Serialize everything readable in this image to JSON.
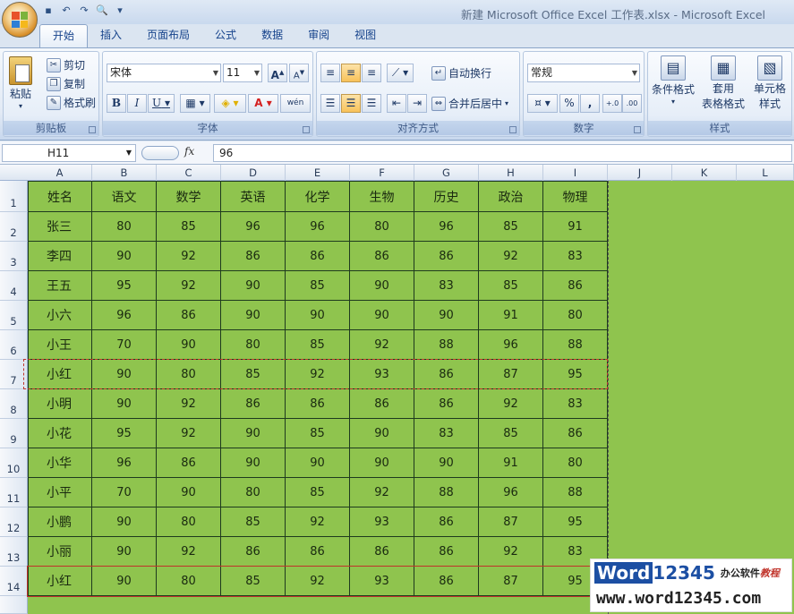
{
  "window": {
    "title": "新建 Microsoft Office Excel 工作表.xlsx - Microsoft Excel"
  },
  "quick_access": [
    {
      "icon": "save-icon",
      "glyph": "▪"
    },
    {
      "icon": "undo-icon",
      "glyph": "↶"
    },
    {
      "icon": "redo-icon",
      "glyph": "↷"
    },
    {
      "icon": "print-preview-icon",
      "glyph": "🔍"
    },
    {
      "icon": "customize-icon",
      "glyph": "▾"
    }
  ],
  "tabs": [
    "开始",
    "插入",
    "页面布局",
    "公式",
    "数据",
    "审阅",
    "视图"
  ],
  "active_tab": "开始",
  "ribbon": {
    "clipboard": {
      "label": "剪贴板",
      "paste": "粘贴",
      "cut": "剪切",
      "copy": "复制",
      "format_painter": "格式刷"
    },
    "font": {
      "label": "字体",
      "font_name": "宋体",
      "font_size": "11",
      "grow": "A",
      "shrink": "A",
      "bold": "B",
      "italic": "I",
      "underline": "U",
      "font_color": "A",
      "phonetic": "wén"
    },
    "alignment": {
      "label": "对齐方式",
      "wrap_text": "自动换行",
      "merge_center": "合并后居中"
    },
    "number": {
      "label": "数字",
      "format": "常规",
      "percent": "%",
      "comma": ",",
      "inc_decimal": "+.0",
      "dec_decimal": ".00"
    },
    "styles": {
      "label": "样式",
      "conditional": "条件格式",
      "table_line1": "套用",
      "table_line2": "表格格式",
      "cell_line1": "单元格",
      "cell_line2": "样式"
    }
  },
  "formula_bar": {
    "name_box": "H11",
    "fx": "fx",
    "value": "96"
  },
  "columns": [
    "A",
    "B",
    "C",
    "D",
    "E",
    "F",
    "G",
    "H",
    "I",
    "J",
    "K",
    "L"
  ],
  "rows": [
    "1",
    "2",
    "3",
    "4",
    "5",
    "6",
    "7",
    "8",
    "9",
    "10",
    "11",
    "12",
    "13",
    "14"
  ],
  "colors": {
    "sheet_fill": "#8fc44e",
    "marquee": "#c0332a"
  },
  "table": {
    "headers": [
      "姓名",
      "语文",
      "数学",
      "英语",
      "化学",
      "生物",
      "历史",
      "政治",
      "物理"
    ],
    "rows": [
      [
        "张三",
        "80",
        "85",
        "96",
        "96",
        "80",
        "96",
        "85",
        "91"
      ],
      [
        "李四",
        "90",
        "92",
        "86",
        "86",
        "86",
        "86",
        "92",
        "83"
      ],
      [
        "王五",
        "95",
        "92",
        "90",
        "85",
        "90",
        "83",
        "85",
        "86"
      ],
      [
        "小六",
        "96",
        "86",
        "90",
        "90",
        "90",
        "90",
        "91",
        "80"
      ],
      [
        "小王",
        "70",
        "90",
        "80",
        "85",
        "92",
        "88",
        "96",
        "88"
      ],
      [
        "小红",
        "90",
        "80",
        "85",
        "92",
        "93",
        "86",
        "87",
        "95"
      ],
      [
        "小明",
        "90",
        "92",
        "86",
        "86",
        "86",
        "86",
        "92",
        "83"
      ],
      [
        "小花",
        "95",
        "92",
        "90",
        "85",
        "90",
        "83",
        "85",
        "86"
      ],
      [
        "小华",
        "96",
        "86",
        "90",
        "90",
        "90",
        "90",
        "91",
        "80"
      ],
      [
        "小平",
        "70",
        "90",
        "80",
        "85",
        "92",
        "88",
        "96",
        "88"
      ],
      [
        "小鹏",
        "90",
        "80",
        "85",
        "92",
        "93",
        "86",
        "87",
        "95"
      ],
      [
        "小丽",
        "90",
        "92",
        "86",
        "86",
        "86",
        "86",
        "92",
        "83"
      ],
      [
        "小红",
        "90",
        "80",
        "85",
        "92",
        "93",
        "86",
        "87",
        "95"
      ]
    ]
  },
  "watermark": {
    "brand_word": "Word",
    "brand_num": "12345",
    "tagline_a": "办公软件",
    "tagline_b": "教程",
    "url": "www.word12345.com"
  }
}
